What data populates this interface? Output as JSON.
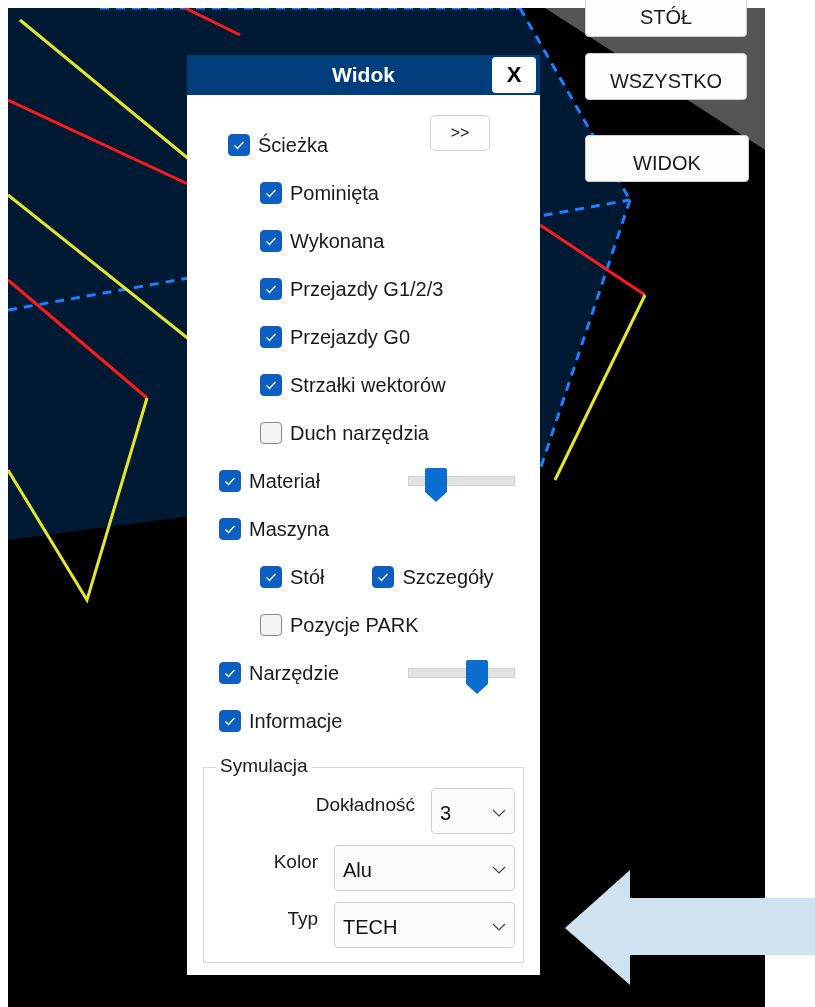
{
  "canvas_buttons": [
    {
      "label": "STÓŁ"
    },
    {
      "label": "WSZYSTKO"
    },
    {
      "label": "WIDOK"
    }
  ],
  "panel": {
    "title": "Widok",
    "close": "X",
    "expand_button": ">>",
    "options": [
      {
        "label": "Ścieżka",
        "checked": true,
        "children": [
          {
            "label": "Pominięta",
            "checked": true
          },
          {
            "label": "Wykonana",
            "checked": true
          },
          {
            "label": "Przejazdy G1/2/3",
            "checked": true
          },
          {
            "label": "Przejazdy G0",
            "checked": true
          },
          {
            "label": "Strzałki wektorów",
            "checked": true
          },
          {
            "label": "Duch narzędzia",
            "checked": false
          }
        ]
      },
      {
        "label": "Materiał",
        "checked": true,
        "slider": {
          "level": 0.26
        }
      },
      {
        "label": "Maszyna",
        "checked": true,
        "children": [
          {
            "label": "Stół",
            "checked": true,
            "same_line": false
          },
          {
            "label": "Szczegóły",
            "checked": true,
            "same_line": true
          },
          {
            "label": "Pozycje PARK",
            "checked": false,
            "same_line": false
          }
        ]
      },
      {
        "label": "Narzędzie",
        "checked": true,
        "slider": {
          "level": 0.65
        }
      },
      {
        "label": "Informacje",
        "checked": true
      }
    ],
    "simulation": {
      "title": "Symulacja",
      "fields": [
        {
          "label": "Dokładność",
          "value": "3",
          "kind": "narrow"
        },
        {
          "label": "Kolor",
          "value": "Alu",
          "kind": "wide"
        },
        {
          "label": "Typ",
          "value": "TECH",
          "kind": "wide"
        }
      ]
    }
  }
}
